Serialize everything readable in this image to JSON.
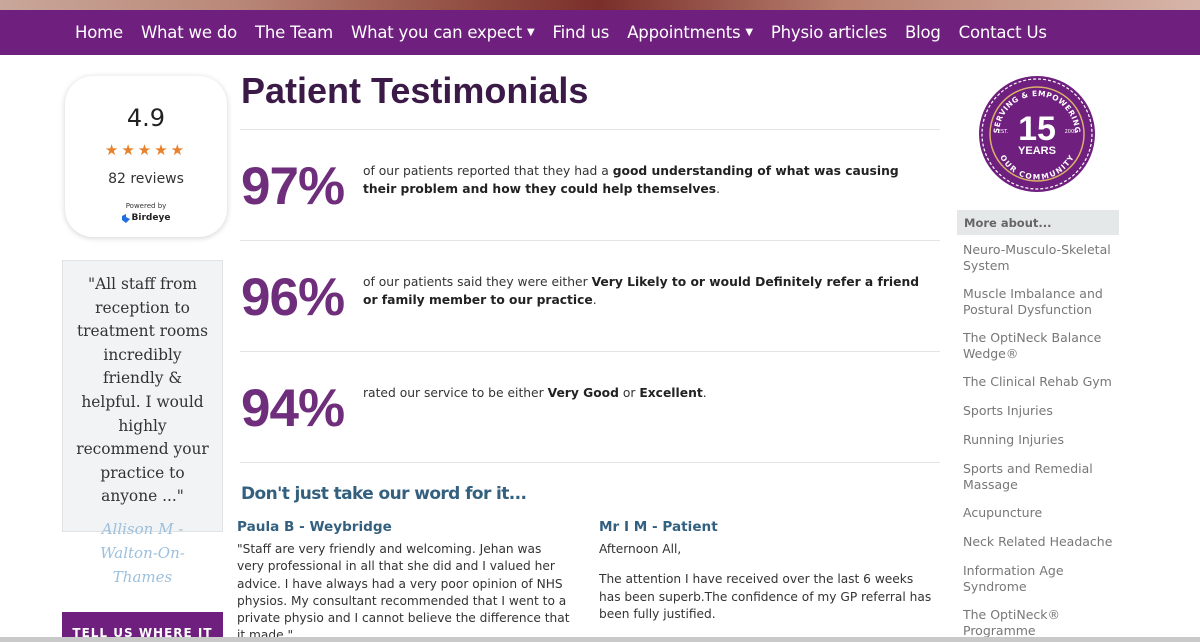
{
  "nav": {
    "items": [
      {
        "label": "Home",
        "dropdown": false
      },
      {
        "label": "What we do",
        "dropdown": false
      },
      {
        "label": "The Team",
        "dropdown": false
      },
      {
        "label": "What you can expect",
        "dropdown": true
      },
      {
        "label": "Find us",
        "dropdown": false
      },
      {
        "label": "Appointments",
        "dropdown": true
      },
      {
        "label": "Physio articles",
        "dropdown": false
      },
      {
        "label": "Blog",
        "dropdown": false
      },
      {
        "label": "Contact Us",
        "dropdown": false
      }
    ]
  },
  "rating": {
    "score": "4.9",
    "stars": "★★★★★",
    "star_count": 5,
    "reviews": "82 reviews",
    "powered_by": "Powered by",
    "provider": "Birdeye"
  },
  "side_quote": {
    "text": "\"All staff from reception to treatment rooms incredibly friendly & helpful. I would highly recommend your practice to anyone ...\"",
    "author": "Allison M - Walton-On-Thames"
  },
  "tell_banner": "TELL US WHERE IT",
  "page_title": "Patient Testimonials",
  "stats": [
    {
      "number": "97%",
      "lead": "of our patients reported that they had a ",
      "bold": "good understanding of what was causing their problem and how they could help themselves",
      "tail": "."
    },
    {
      "number": "96%",
      "lead": "of our patients said they were either ",
      "bold": "Very Likely to or would Definitely refer a friend or family member to our practice",
      "tail": "."
    },
    {
      "number": "94%",
      "lead": "rated our service to be either ",
      "bold": "Very Good",
      "mid": " or ",
      "bold2": "Excellent",
      "tail": "."
    }
  ],
  "word_heading": "Don't just take our word for it...",
  "reviews": [
    {
      "name": "Paula B - Weybridge",
      "paragraphs": [
        "\"Staff are very friendly and welcoming. Jehan was very professional in all that she did and I valued her advice. I have always had a very poor opinion of NHS physios. My consultant recommended that I went to a private physio and I cannot believe the difference that it made.\""
      ]
    },
    {
      "name": "Mr I M - Patient",
      "paragraphs": [
        "Afternoon All,",
        "The attention I have received over the last 6 weeks has been superb.The confidence of my GP referral has been fully justified."
      ]
    }
  ],
  "badge": {
    "top_arc": "SERVING & EMPOWERING",
    "bottom_arc": "OUR COMMUNITY",
    "number": "15",
    "years": "YEARS",
    "est": "EST.",
    "year": "2005",
    "color": "#6f1f7e",
    "gold": "#d9b06b"
  },
  "more_about": {
    "header": "More about...",
    "items": [
      "Neuro-Musculo-Skeletal System",
      "Muscle Imbalance and Postural Dysfunction",
      "The OptiNeck Balance Wedge®",
      "The Clinical Rehab Gym",
      "Sports Injuries",
      "Running Injuries",
      "Sports and Remedial Massage",
      "Acupuncture",
      "Neck Related Headache",
      "Information Age Syndrome",
      "The OptiNeck® Programme"
    ]
  },
  "colors": {
    "brand_purple": "#6f1f7e",
    "stat_purple": "#6f2e7c",
    "heading_blue": "#34607f",
    "star_orange": "#e8812b"
  }
}
